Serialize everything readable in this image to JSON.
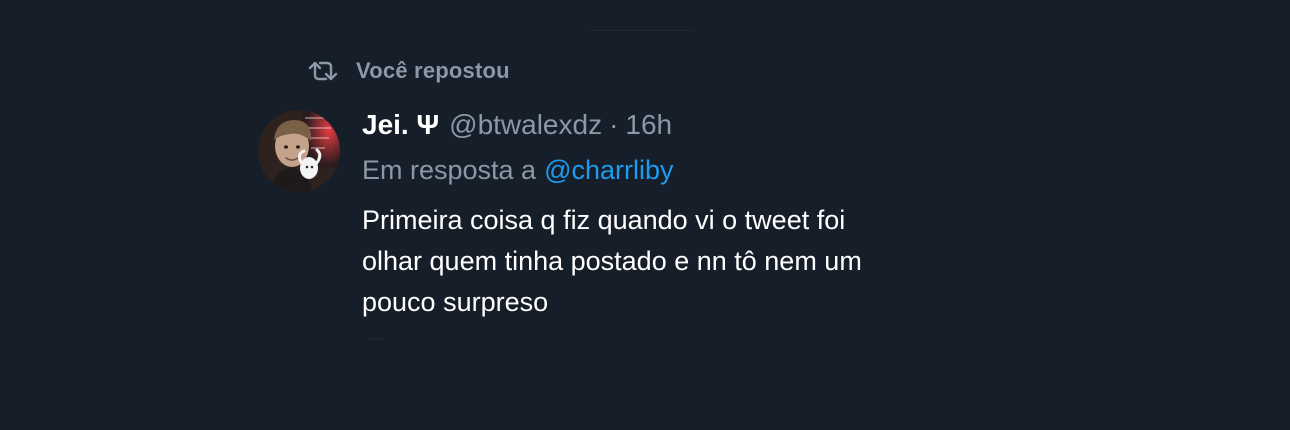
{
  "repost": {
    "label": "Você repostou",
    "icon": "retweet-icon"
  },
  "tweet": {
    "avatar": {
      "icon": "avatar"
    },
    "author": {
      "name": "Jei. Ψ",
      "handle": "@btwalexdz"
    },
    "separator": "·",
    "time": "16h",
    "reply": {
      "prefix": "Em resposta a",
      "handle": "@charrliby"
    },
    "body_lines": [
      "Primeira coisa q fiz quando vi o tweet foi",
      "olhar quem tinha postado e nn tô nem um",
      "pouco surpreso"
    ]
  },
  "colors": {
    "background": "#161e29",
    "primary_text": "#ffffff",
    "secondary_text": "#8b98a5",
    "link": "#1d9bf0"
  }
}
